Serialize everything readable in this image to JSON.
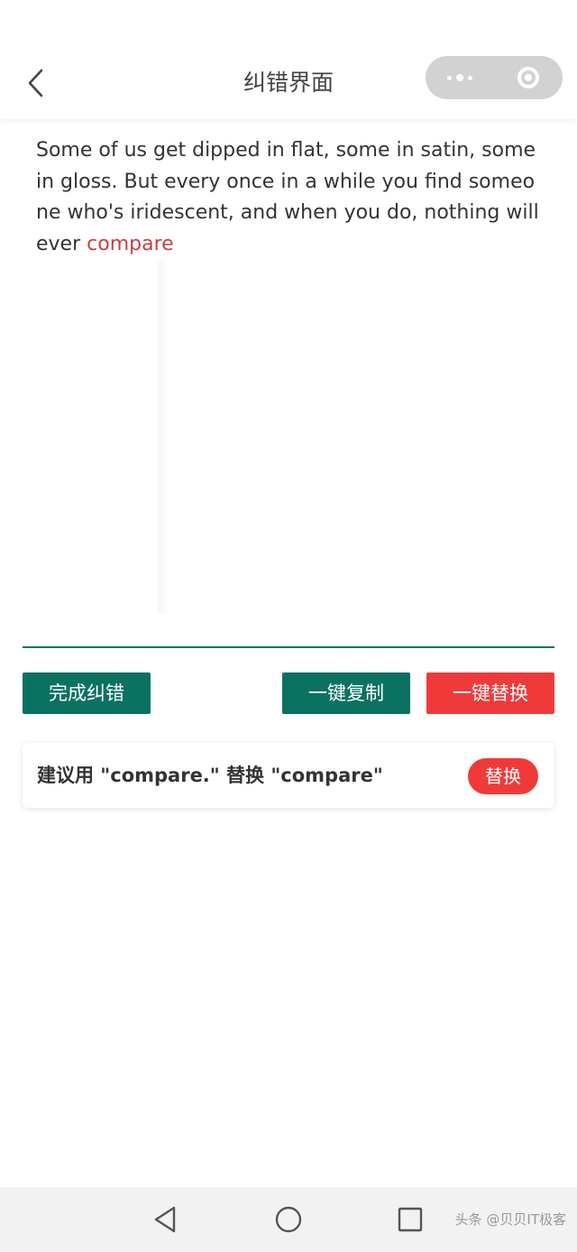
{
  "header": {
    "title": "纠错界面",
    "back_icon": "chevron-left-icon",
    "more_icon": "more-dots-icon",
    "close_icon": "target-circle-icon"
  },
  "editor": {
    "text_before": "Some of us get dipped in flat, some in satin, some in gloss. But every once in a while you find someone who's iridescent, and when you do, nothing will ever ",
    "error_word": "compare",
    "error_color": "#c8413d"
  },
  "actions": {
    "finish_label": "完成纠错",
    "copy_label": "一键复制",
    "replace_all_label": "一键替换"
  },
  "suggestion": {
    "text": "建议用 \"compare.\" 替换 \"compare\"",
    "replace_label": "替换"
  },
  "colors": {
    "accent_green": "#0b7262",
    "accent_red": "#f03a3a"
  },
  "system_nav": {
    "back_icon": "triangle-back-icon",
    "home_icon": "circle-home-icon",
    "recent_icon": "square-recent-icon"
  },
  "watermark": "头条 @贝贝IT极客"
}
